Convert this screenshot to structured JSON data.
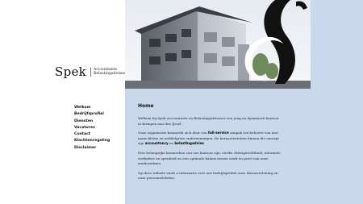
{
  "brand": {
    "name": "Spek",
    "tagline_line1": "Accountants",
    "tagline_line2": "Belastingadviseurs"
  },
  "nav": {
    "items": [
      {
        "label": "Welkom"
      },
      {
        "label": "Bedrijfsprofiel"
      },
      {
        "label": "Diensten"
      },
      {
        "label": "Vacatures"
      },
      {
        "label": "Contact"
      },
      {
        "label": "Klachtenregeling"
      },
      {
        "label": "Disclaimer"
      }
    ]
  },
  "main": {
    "title": "Home",
    "p1": "Welkom bij Spek Accountants en Belastingadviseurs een jong en dynamisch kantoor in Krimpen aan den IJssel.",
    "p2_a": "Onze organisatie kenmerkt zich door een ",
    "p2_b1": "full-service",
    "p2_c": " aanpak ten behoeve van met name kleine en middelgrote ondernemingen. De kernactiviteiten binnen dit concept zijn ",
    "p2_b2": "accountancy",
    "p2_d": " en ",
    "p2_b3": "belastingadvies",
    "p2_e": ".",
    "p3": "Drie belangrijke kenmerken van ons kantoor zijn: sterke cliëntgerichtheid, informele werksfeer en openheid en een optimale balans tussen werk en privé van onze medewerkers.",
    "p4": "Op deze website vindt u informatie over ons bedrijfsprofiel onze dienstverlening en onze personeelsleden."
  },
  "colors": {
    "panel": "#c9d8ea",
    "text": "#223344"
  }
}
